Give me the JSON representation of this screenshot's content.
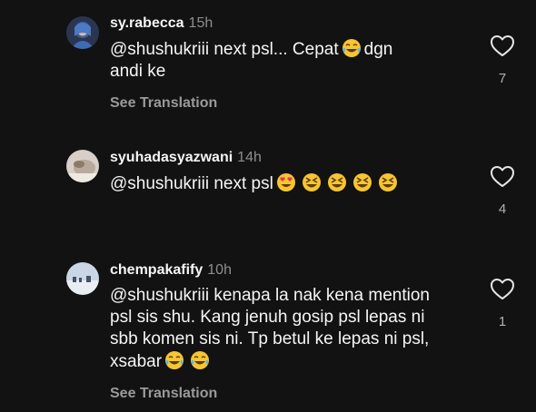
{
  "comments": [
    {
      "username": "sy.rabecca",
      "time": "15h",
      "text_a": "@shushukriii next psl... Cepat",
      "text_b": "dgn\nandi ke",
      "emoji_inline": [
        "tears-of-joy-emoji"
      ],
      "see_translation": "See Translation",
      "likes": "7"
    },
    {
      "username": "syuhadasyazwani",
      "time": "14h",
      "text_a": "@shushukriii next psl",
      "emoji_trailing": [
        "heart-eyes-emoji",
        "grinning-squint-emoji",
        "grinning-squint-emoji",
        "grinning-squint-emoji",
        "grinning-squint-emoji"
      ],
      "likes": "4"
    },
    {
      "username": "chempakafify",
      "time": "10h",
      "text_a": "@shushukriii kenapa la nak kena mention\npsl sis shu. Kang jenuh gosip psl lepas ni\nsbb komen sis ni. Tp betul ke lepas ni psl,\nxsabar",
      "emoji_trailing": [
        "tears-of-joy-emoji",
        "tears-of-joy-emoji"
      ],
      "see_translation": "See Translation",
      "likes": "1"
    }
  ],
  "colors": {
    "background": "#121212",
    "text": "#f5f5f5",
    "secondary": "#8e8e8e",
    "emoji_yellow": "#f7c531"
  }
}
